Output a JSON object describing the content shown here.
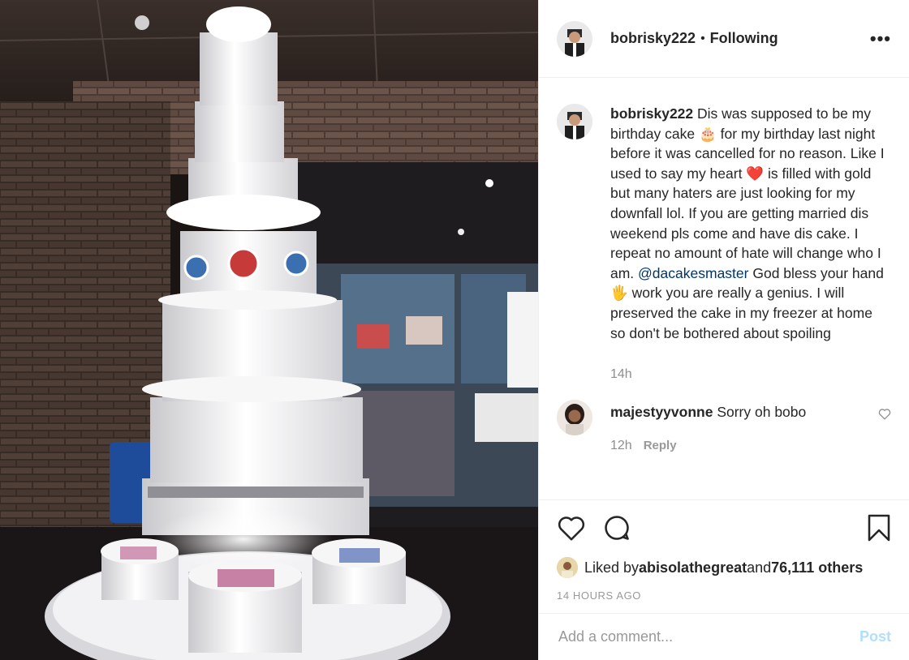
{
  "post": {
    "username": "bobrisky222",
    "separator": "•",
    "follow_status": "Following",
    "more_icon": "more-horizontal-icon"
  },
  "caption": {
    "username": "bobrisky222",
    "text_part1": " Dis was supposed to be my birthday cake 🎂 for my birthday last night before it was cancelled for no reason. Like I used to say my heart ❤️ is filled with gold but many haters are just looking for my downfall lol. If you are getting married dis weekend pls come and have dis cake. I repeat no amount of hate will change who I am. ",
    "mention": "@dacakesmaster",
    "text_part2": " God bless your hand 🖐 work you are really a genius. I will preserved the cake in my freezer at home so don't be bothered about spoiling",
    "time": "14h"
  },
  "comment": {
    "username": "majestyyvonne",
    "text": " Sorry oh bobo",
    "time": "12h",
    "reply_label": "Reply"
  },
  "actions": {
    "like_icon": "heart-icon",
    "comment_icon": "comment-icon",
    "save_icon": "bookmark-icon"
  },
  "likes": {
    "prefix": "Liked by ",
    "user": "abisolathegreat",
    "middle": " and ",
    "others": "76,111 others"
  },
  "timestamp": "14 HOURS AGO",
  "add_comment": {
    "placeholder": "Add a comment...",
    "post_label": "Post"
  },
  "colors": {
    "text": "#262626",
    "muted": "#8e8e8e",
    "link": "#003569",
    "post_disabled": "#b2dffc",
    "border": "#efefef"
  }
}
